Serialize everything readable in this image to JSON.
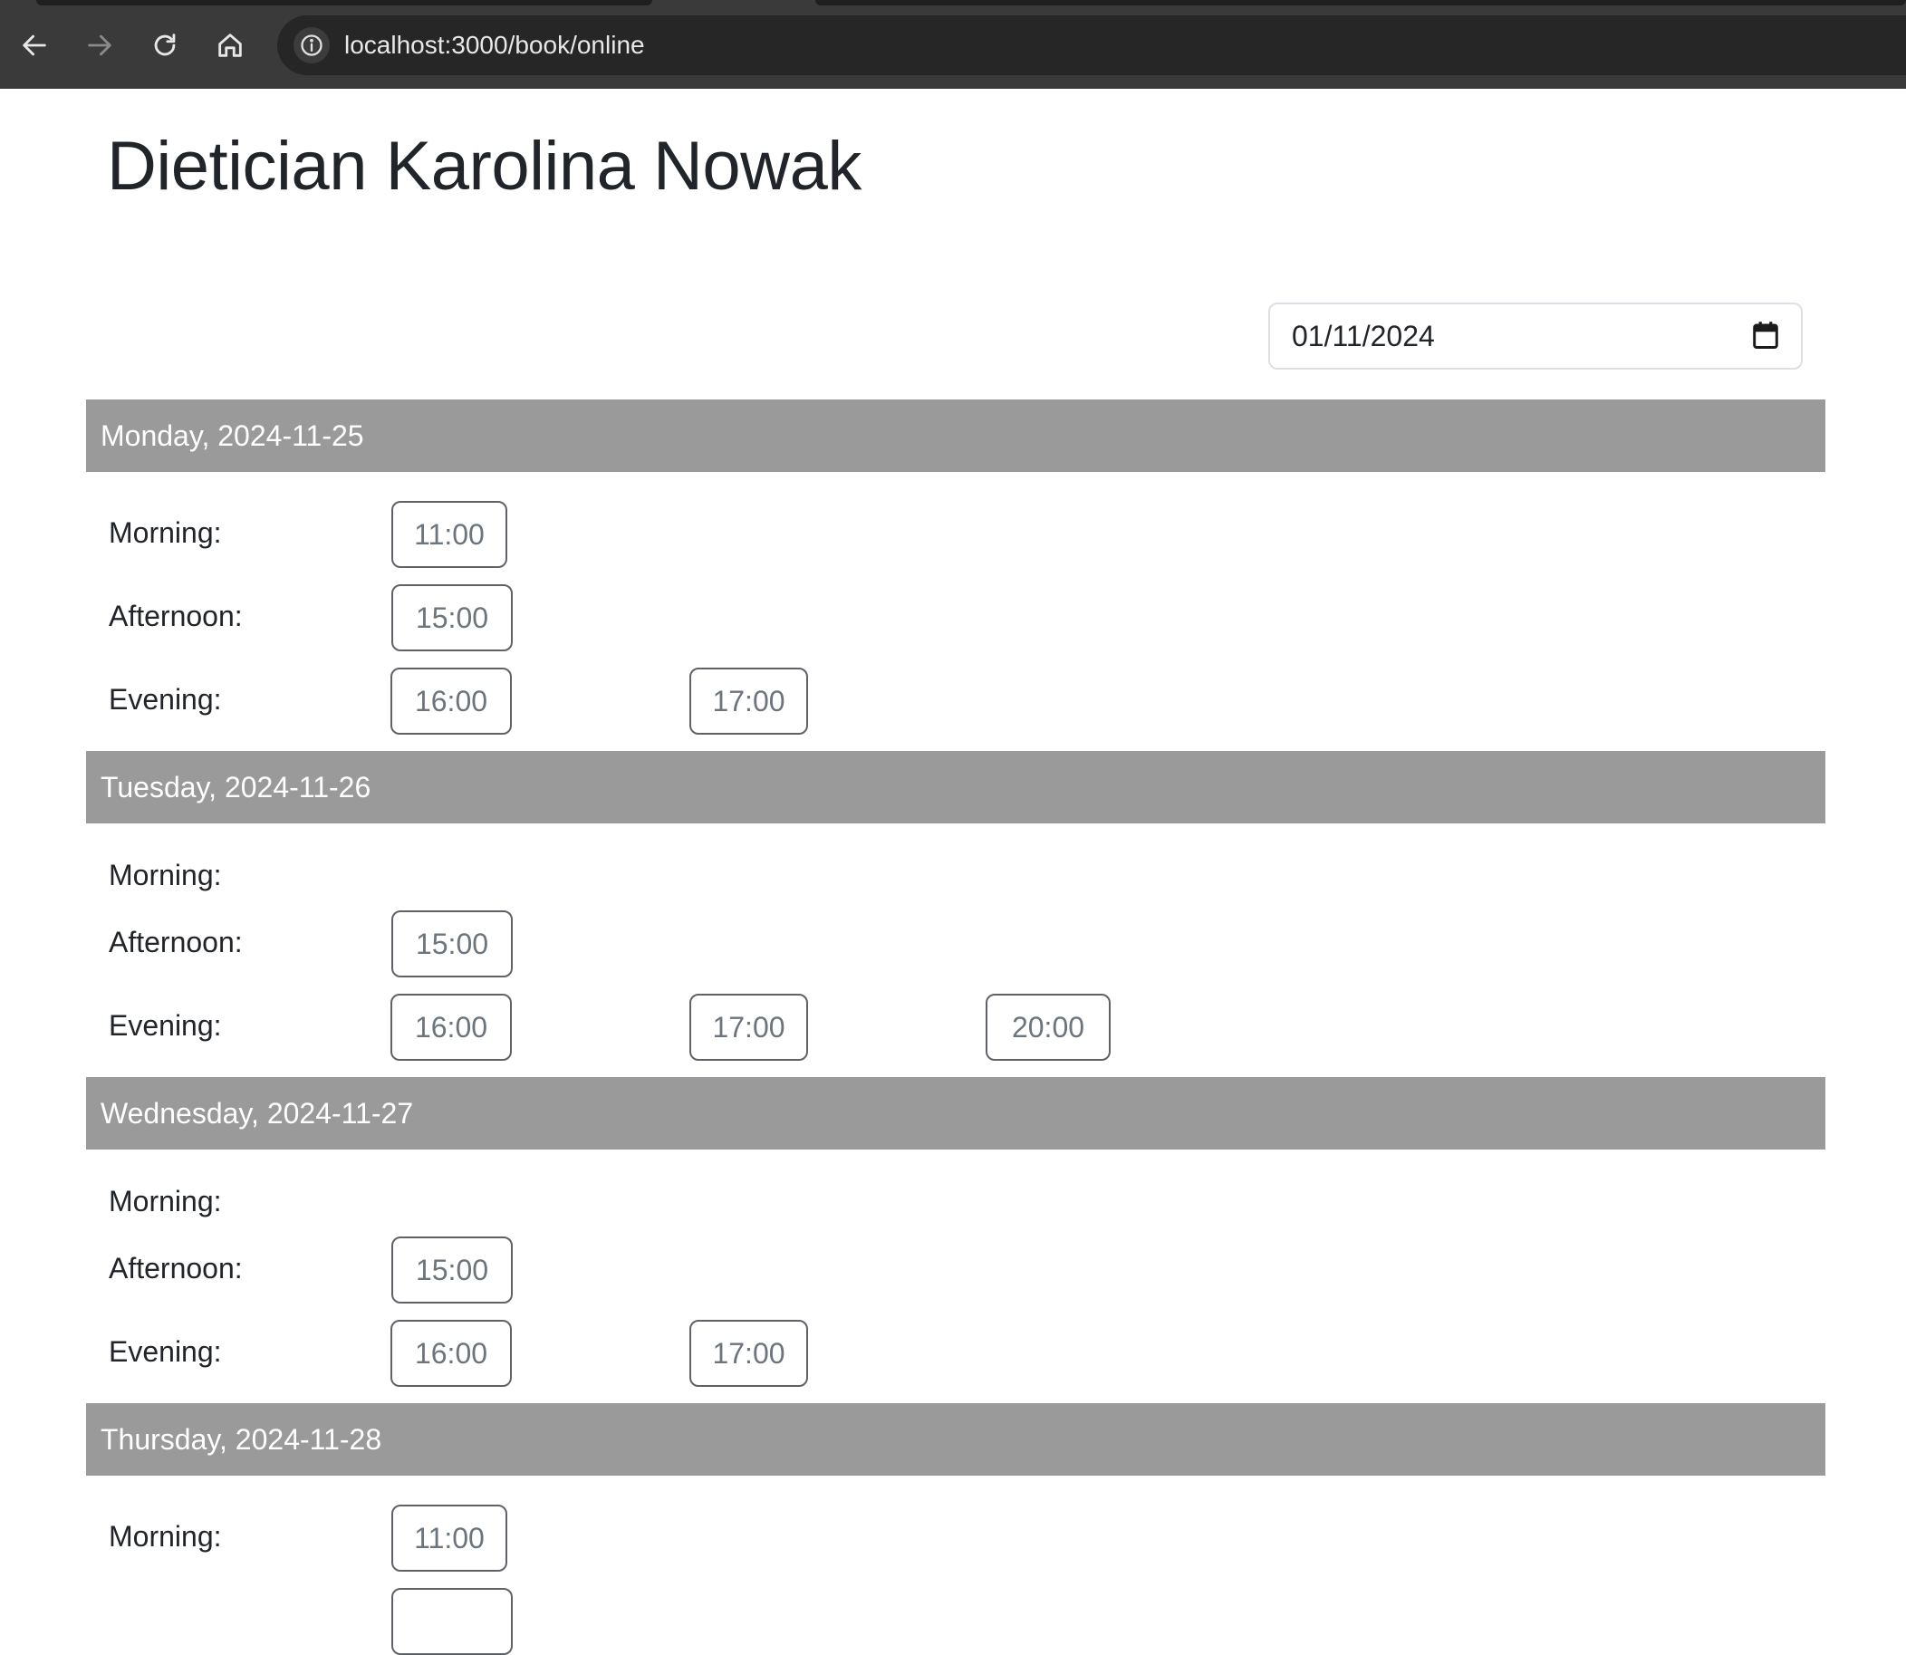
{
  "browser": {
    "url": "localhost:3000/book/online"
  },
  "page": {
    "title": "Dietician Karolina Nowak",
    "date_input_value": "01/11/2024"
  },
  "days": [
    {
      "header": "Monday, 2024-11-25",
      "periods": [
        {
          "label": "Morning:",
          "slots": [
            "11:00"
          ]
        },
        {
          "label": "Afternoon:",
          "slots": [
            "15:00"
          ]
        },
        {
          "label": "Evening:",
          "slots": [
            "16:00",
            "17:00"
          ]
        }
      ]
    },
    {
      "header": "Tuesday, 2024-11-26",
      "periods": [
        {
          "label": "Morning:",
          "slots": []
        },
        {
          "label": "Afternoon:",
          "slots": [
            "15:00"
          ]
        },
        {
          "label": "Evening:",
          "slots": [
            "16:00",
            "17:00",
            "20:00"
          ]
        }
      ]
    },
    {
      "header": "Wednesday, 2024-11-27",
      "periods": [
        {
          "label": "Morning:",
          "slots": []
        },
        {
          "label": "Afternoon:",
          "slots": [
            "15:00"
          ]
        },
        {
          "label": "Evening:",
          "slots": [
            "16:00",
            "17:00"
          ]
        }
      ]
    },
    {
      "header": "Thursday, 2024-11-28",
      "periods": [
        {
          "label": "Morning:",
          "slots": [
            "11:00"
          ]
        }
      ]
    }
  ]
}
